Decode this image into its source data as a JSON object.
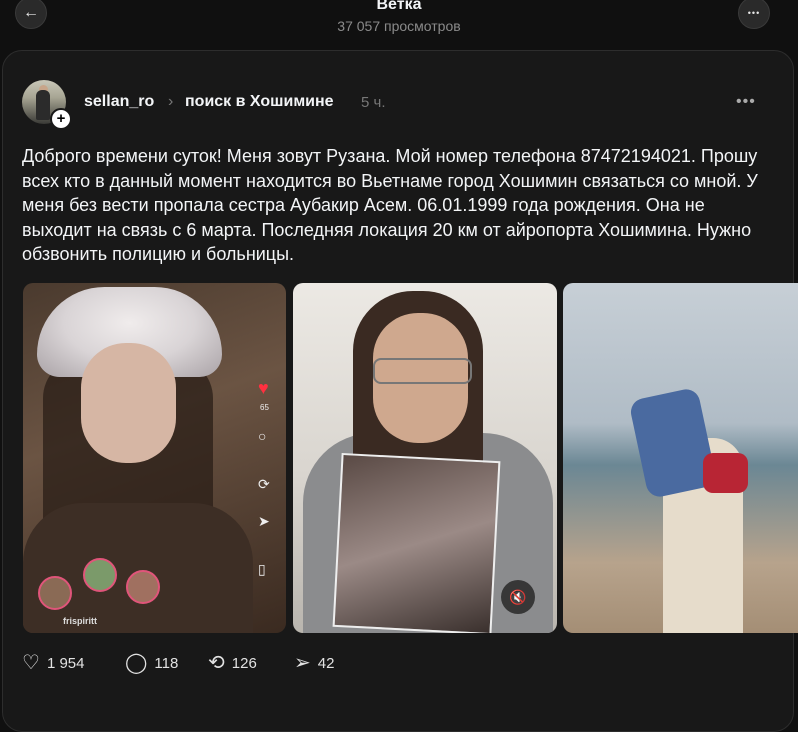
{
  "header": {
    "title": "Ветка",
    "subtitle": "37 057 просмотров",
    "back_icon": "←",
    "more_icon": "•••"
  },
  "post": {
    "username": "sellan_ro",
    "separator": "›",
    "topic": "поиск в Хошимине",
    "time": "5 ч.",
    "more_icon": "•••",
    "follow_icon": "+",
    "text": "Доброго времени суток! Меня зовут Рузана. Мой номер телефона 87472194021. Прошу всех кто в данный момент находится во Вьетнаме город Хошимин связаться со мной. У меня без вести пропала сестра Аубакир Асем. 06.01.1999 года рождения. Она не выходит на связь с 6 марта. Последняя локация 20 км от айропорта Хошимина. Нужно обзвонить полицию и больницы.",
    "media": [
      {
        "kind": "video-screenshot",
        "overlay": {
          "likes": "65",
          "handle": "frispiritt"
        }
      },
      {
        "kind": "video",
        "mute_icon": "muted-speaker"
      },
      {
        "kind": "photo"
      }
    ],
    "actions": {
      "likes": "1 954",
      "comments": "118",
      "reposts": "126",
      "shares": "42"
    }
  }
}
